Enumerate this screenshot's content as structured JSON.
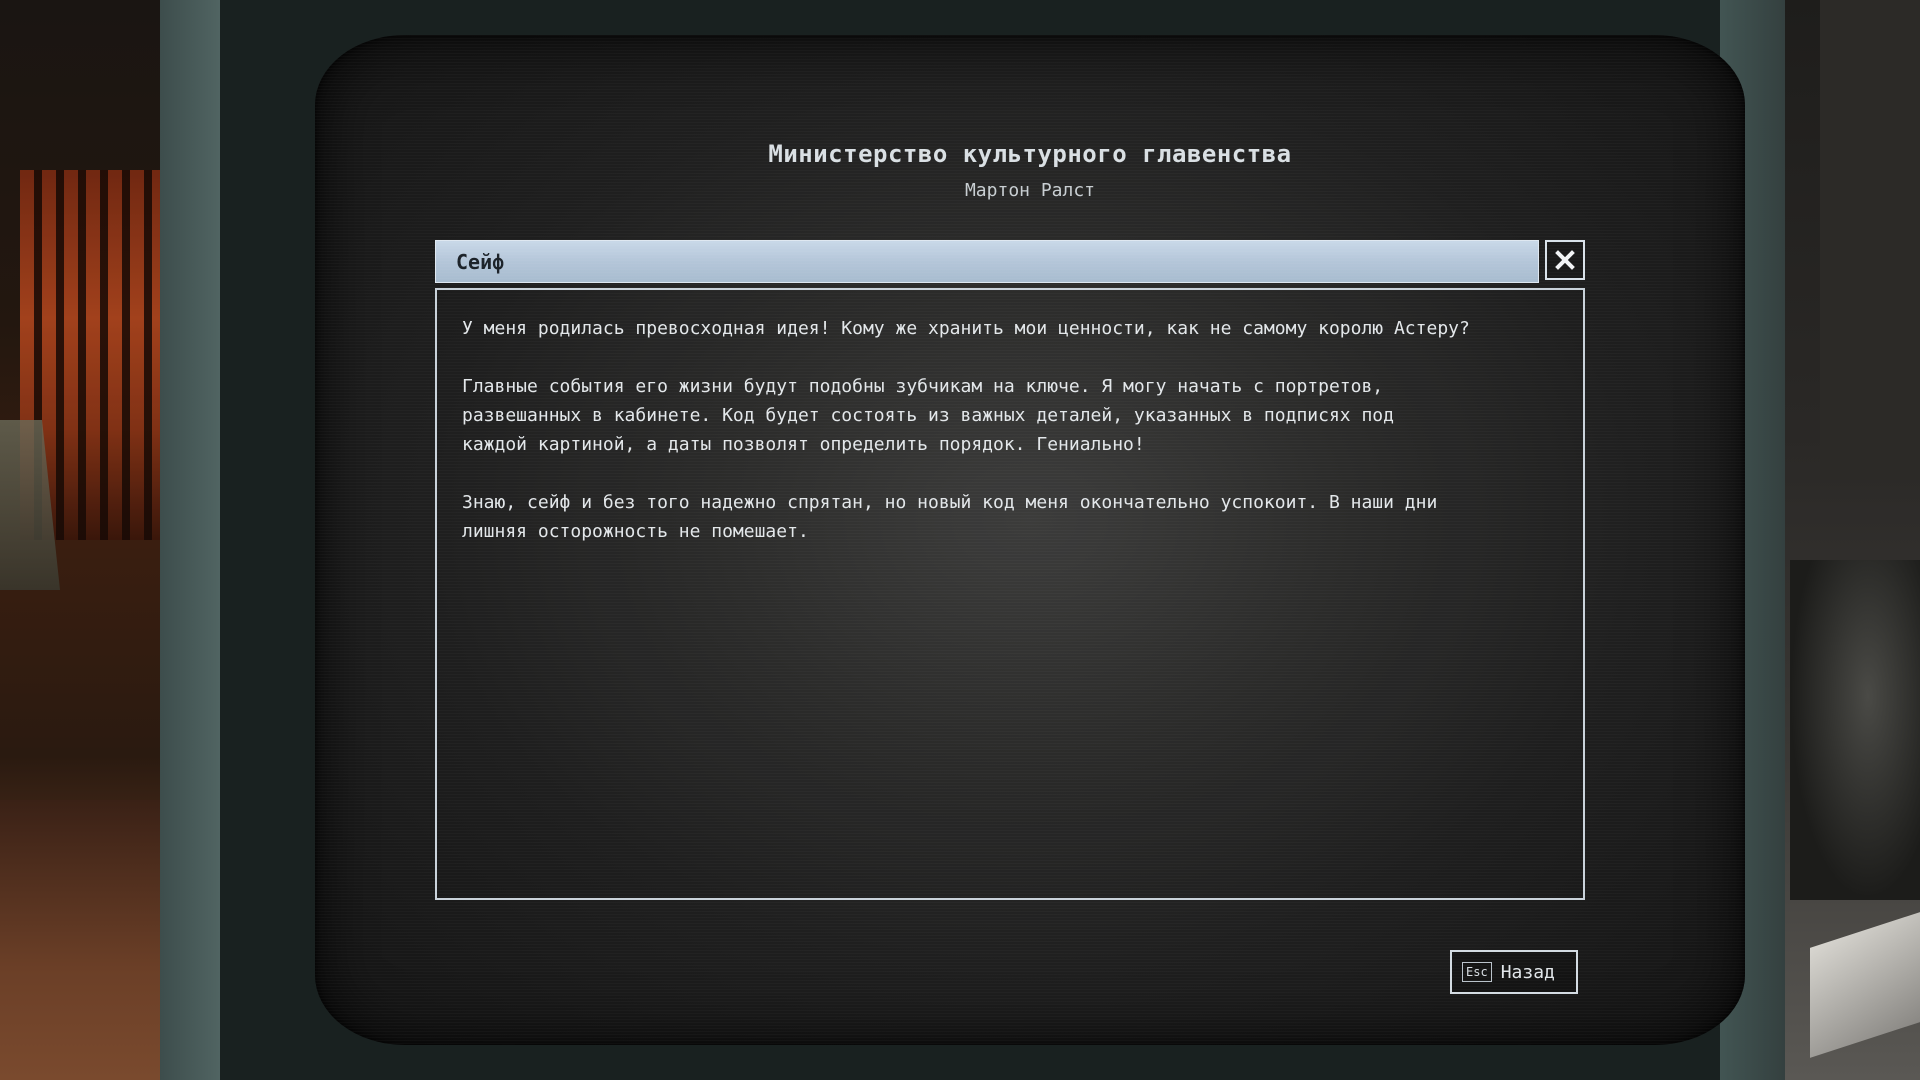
{
  "header": {
    "title": "Министерство культурного главенства",
    "subtitle": "Мартон Ралст"
  },
  "dialog": {
    "title": "Сейф",
    "close_icon": "close-icon",
    "paragraphs": [
      "У меня родилась превосходная идея! Кому же хранить мои ценности, как не самому королю Астеру?",
      "Главные события его жизни будут подобны зубчикам на ключе. Я могу начать с портретов,\nразвешанных в кабинете. Код будет состоять из важных деталей, указанных в подписях под\nкаждой картиной, а даты позволят определить порядок. Гениально!",
      "Знаю, сейф и без того надежно спрятан, но новый код меня окончательно успокоит. В наши дни\nлишняя осторожность не помешает."
    ]
  },
  "footer": {
    "back_key": "Esc",
    "back_label": "Назад"
  },
  "colors": {
    "titlebar": "#b4c6d9",
    "text": "#e3e7ea",
    "border": "#c9d2da",
    "bezel": "#4b5d5b"
  }
}
